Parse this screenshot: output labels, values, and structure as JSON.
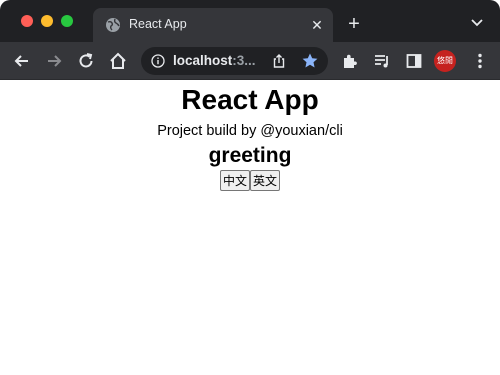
{
  "browser": {
    "tab": {
      "title": "React App"
    },
    "address_bar": {
      "host": "localhost",
      "rest": ":3..."
    },
    "profile": {
      "label": "悠閒",
      "color": "#c5221f"
    },
    "colors": {
      "frame": "#202124",
      "toolbar": "#35363a",
      "star": "#8ab4f8"
    }
  },
  "page": {
    "title": "React App",
    "subtitle": "Project build by @youxian/cli",
    "heading": "greeting",
    "buttons": [
      {
        "label": "中文"
      },
      {
        "label": "英文"
      }
    ]
  }
}
